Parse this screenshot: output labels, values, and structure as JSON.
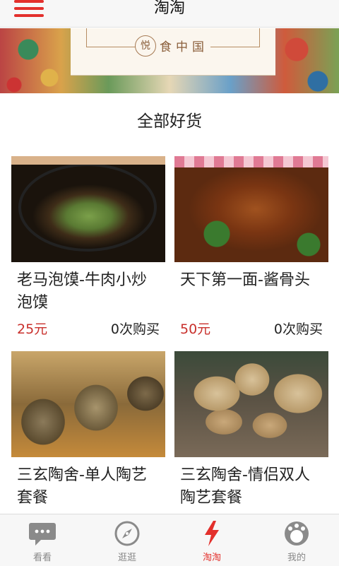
{
  "header": {
    "title": "淘淘"
  },
  "banner": {
    "logo_char": "悦",
    "text": "食中国"
  },
  "section": {
    "title": "全部好货"
  },
  "products": [
    {
      "name": "老马泡馍-牛肉小炒泡馍",
      "price": "25元",
      "sales": "0次购买"
    },
    {
      "name": "天下第一面-酱骨头",
      "price": "50元",
      "sales": "0次购买"
    },
    {
      "name": "三玄陶舍-单人陶艺套餐"
    },
    {
      "name": "三玄陶舍-情侣双人陶艺套餐"
    }
  ],
  "tabbar": {
    "items": [
      {
        "label": "看看",
        "icon": "chat-bubble-icon"
      },
      {
        "label": "逛逛",
        "icon": "compass-icon"
      },
      {
        "label": "淘淘",
        "icon": "lightning-icon",
        "active": true
      },
      {
        "label": "我的",
        "icon": "user-face-icon"
      }
    ]
  },
  "colors": {
    "accent": "#e3302c",
    "price": "#c9302c",
    "tab_inactive": "#888888"
  }
}
